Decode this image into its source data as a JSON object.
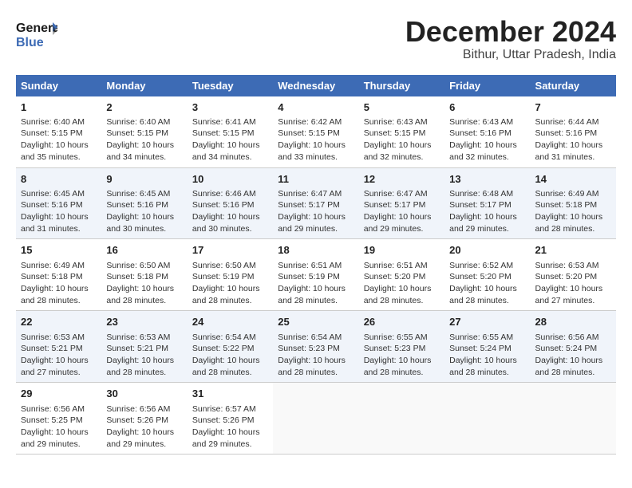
{
  "header": {
    "logo_text_general": "General",
    "logo_text_blue": "Blue",
    "month": "December 2024",
    "location": "Bithur, Uttar Pradesh, India"
  },
  "weekdays": [
    "Sunday",
    "Monday",
    "Tuesday",
    "Wednesday",
    "Thursday",
    "Friday",
    "Saturday"
  ],
  "weeks": [
    [
      {
        "day": "1",
        "info": "Sunrise: 6:40 AM\nSunset: 5:15 PM\nDaylight: 10 hours\nand 35 minutes."
      },
      {
        "day": "2",
        "info": "Sunrise: 6:40 AM\nSunset: 5:15 PM\nDaylight: 10 hours\nand 34 minutes."
      },
      {
        "day": "3",
        "info": "Sunrise: 6:41 AM\nSunset: 5:15 PM\nDaylight: 10 hours\nand 34 minutes."
      },
      {
        "day": "4",
        "info": "Sunrise: 6:42 AM\nSunset: 5:15 PM\nDaylight: 10 hours\nand 33 minutes."
      },
      {
        "day": "5",
        "info": "Sunrise: 6:43 AM\nSunset: 5:15 PM\nDaylight: 10 hours\nand 32 minutes."
      },
      {
        "day": "6",
        "info": "Sunrise: 6:43 AM\nSunset: 5:16 PM\nDaylight: 10 hours\nand 32 minutes."
      },
      {
        "day": "7",
        "info": "Sunrise: 6:44 AM\nSunset: 5:16 PM\nDaylight: 10 hours\nand 31 minutes."
      }
    ],
    [
      {
        "day": "8",
        "info": "Sunrise: 6:45 AM\nSunset: 5:16 PM\nDaylight: 10 hours\nand 31 minutes."
      },
      {
        "day": "9",
        "info": "Sunrise: 6:45 AM\nSunset: 5:16 PM\nDaylight: 10 hours\nand 30 minutes."
      },
      {
        "day": "10",
        "info": "Sunrise: 6:46 AM\nSunset: 5:16 PM\nDaylight: 10 hours\nand 30 minutes."
      },
      {
        "day": "11",
        "info": "Sunrise: 6:47 AM\nSunset: 5:17 PM\nDaylight: 10 hours\nand 29 minutes."
      },
      {
        "day": "12",
        "info": "Sunrise: 6:47 AM\nSunset: 5:17 PM\nDaylight: 10 hours\nand 29 minutes."
      },
      {
        "day": "13",
        "info": "Sunrise: 6:48 AM\nSunset: 5:17 PM\nDaylight: 10 hours\nand 29 minutes."
      },
      {
        "day": "14",
        "info": "Sunrise: 6:49 AM\nSunset: 5:18 PM\nDaylight: 10 hours\nand 28 minutes."
      }
    ],
    [
      {
        "day": "15",
        "info": "Sunrise: 6:49 AM\nSunset: 5:18 PM\nDaylight: 10 hours\nand 28 minutes."
      },
      {
        "day": "16",
        "info": "Sunrise: 6:50 AM\nSunset: 5:18 PM\nDaylight: 10 hours\nand 28 minutes."
      },
      {
        "day": "17",
        "info": "Sunrise: 6:50 AM\nSunset: 5:19 PM\nDaylight: 10 hours\nand 28 minutes."
      },
      {
        "day": "18",
        "info": "Sunrise: 6:51 AM\nSunset: 5:19 PM\nDaylight: 10 hours\nand 28 minutes."
      },
      {
        "day": "19",
        "info": "Sunrise: 6:51 AM\nSunset: 5:20 PM\nDaylight: 10 hours\nand 28 minutes."
      },
      {
        "day": "20",
        "info": "Sunrise: 6:52 AM\nSunset: 5:20 PM\nDaylight: 10 hours\nand 28 minutes."
      },
      {
        "day": "21",
        "info": "Sunrise: 6:53 AM\nSunset: 5:20 PM\nDaylight: 10 hours\nand 27 minutes."
      }
    ],
    [
      {
        "day": "22",
        "info": "Sunrise: 6:53 AM\nSunset: 5:21 PM\nDaylight: 10 hours\nand 27 minutes."
      },
      {
        "day": "23",
        "info": "Sunrise: 6:53 AM\nSunset: 5:21 PM\nDaylight: 10 hours\nand 28 minutes."
      },
      {
        "day": "24",
        "info": "Sunrise: 6:54 AM\nSunset: 5:22 PM\nDaylight: 10 hours\nand 28 minutes."
      },
      {
        "day": "25",
        "info": "Sunrise: 6:54 AM\nSunset: 5:23 PM\nDaylight: 10 hours\nand 28 minutes."
      },
      {
        "day": "26",
        "info": "Sunrise: 6:55 AM\nSunset: 5:23 PM\nDaylight: 10 hours\nand 28 minutes."
      },
      {
        "day": "27",
        "info": "Sunrise: 6:55 AM\nSunset: 5:24 PM\nDaylight: 10 hours\nand 28 minutes."
      },
      {
        "day": "28",
        "info": "Sunrise: 6:56 AM\nSunset: 5:24 PM\nDaylight: 10 hours\nand 28 minutes."
      }
    ],
    [
      {
        "day": "29",
        "info": "Sunrise: 6:56 AM\nSunset: 5:25 PM\nDaylight: 10 hours\nand 29 minutes."
      },
      {
        "day": "30",
        "info": "Sunrise: 6:56 AM\nSunset: 5:26 PM\nDaylight: 10 hours\nand 29 minutes."
      },
      {
        "day": "31",
        "info": "Sunrise: 6:57 AM\nSunset: 5:26 PM\nDaylight: 10 hours\nand 29 minutes."
      },
      {
        "day": "",
        "info": ""
      },
      {
        "day": "",
        "info": ""
      },
      {
        "day": "",
        "info": ""
      },
      {
        "day": "",
        "info": ""
      }
    ]
  ]
}
